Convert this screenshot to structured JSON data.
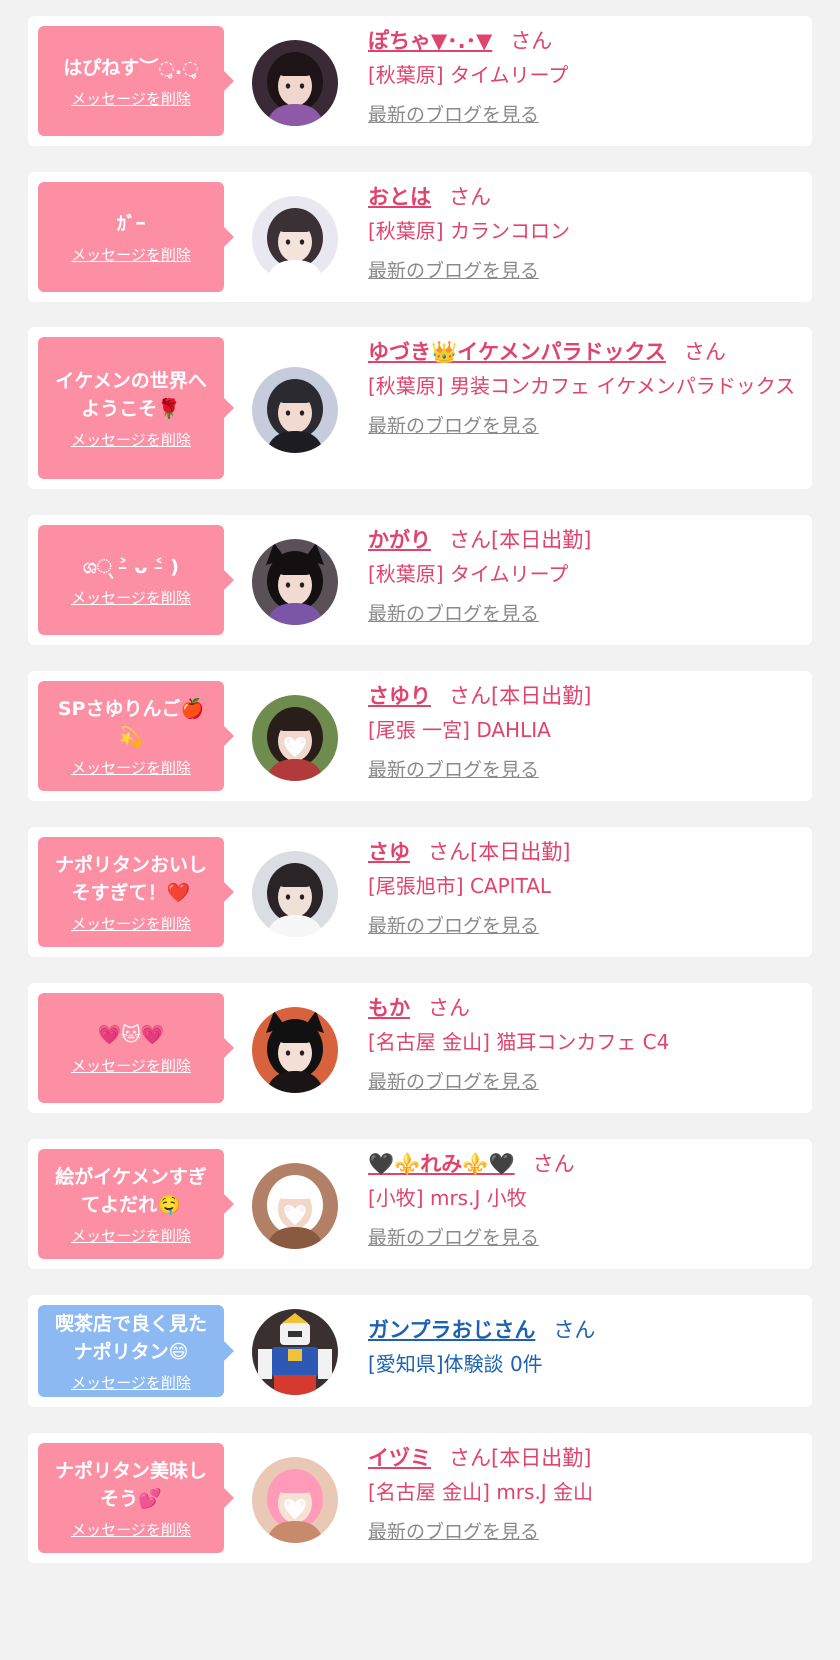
{
  "delete_label": "メッセージを削除",
  "blog_label": "最新のブログを見る",
  "colors": {
    "pink_bubble": "#fd8fa5",
    "blue_bubble": "#8db9f3",
    "pink_text": "#e0436c",
    "blue_text": "#1d62b0",
    "link_gray": "#8a8a8a",
    "background": "#f2f2f2"
  },
  "items": [
    {
      "message": "はぴねす︶◌̥.◌̥",
      "name": "ぽちゃ▼･.･▼",
      "suffix": "さん",
      "shop": "[秋葉原] タイムリープ",
      "blog": true,
      "style": "pink",
      "avatar": "photo-girl-purple-kimono"
    },
    {
      "message": "ｶﾞｰ",
      "name": "おとは",
      "suffix": "さん",
      "shop": "[秋葉原] カランコロン",
      "blog": true,
      "style": "pink",
      "avatar": "photo-girl-white-room"
    },
    {
      "message": "イケメンの世界へ\nようこそ🌹",
      "name": "ゆづき👑イケメンパラドックス",
      "suffix": "さん",
      "shop": "[秋葉原] 男装コンカフェ イケメンパラドックス",
      "blog": true,
      "style": "pink",
      "avatar": "photo-dark-hair-suit"
    },
    {
      "message": "ශ્ ˃̵ ᴗ ˂̵ )",
      "name": "かがり",
      "suffix": "さん[本日出勤]",
      "shop": "[秋葉原] タイムリープ",
      "blog": true,
      "style": "pink",
      "avatar": "photo-cat-ears-purple"
    },
    {
      "message": "SPさゆりんご🍎\n💫",
      "name": "さゆり",
      "suffix": "さん[本日出勤]",
      "shop": "[尾張 一宮] DAHLIA",
      "blog": true,
      "style": "pink",
      "avatar": "photo-apple-orchard"
    },
    {
      "message": "ナポリタンおいし\nそすぎて！❤️",
      "name": "さゆ",
      "suffix": "さん[本日出勤]",
      "shop": "[尾張旭市] CAPITAL",
      "blog": true,
      "style": "pink",
      "avatar": "photo-white-hood"
    },
    {
      "message": "💗🐱💗",
      "name": "もか",
      "suffix": "さん",
      "shop": "[名古屋 金山] 猫耳コンカフェ C4",
      "blog": true,
      "style": "pink",
      "avatar": "photo-cat-ears-black"
    },
    {
      "message": "絵がイケメンすぎ\nてよだれ🤤",
      "name": "🖤⚜️れみ⚜️🖤",
      "suffix": "さん",
      "shop": "[小牧] mrs.J 小牧",
      "blog": true,
      "style": "pink",
      "avatar": "photo-brown-hair-heart"
    },
    {
      "message": "喫茶店で良く見た\nナポリタン😄",
      "name": "ガンプラおじさん",
      "suffix": "さん",
      "shop": "[愛知県]体験談 0件",
      "blog": false,
      "style": "blue",
      "avatar": "photo-gundam-model"
    },
    {
      "message": "ナポリタン美味し\nそう💕",
      "name": "イヅミ",
      "suffix": "さん[本日出勤]",
      "shop": "[名古屋 金山] mrs.J 金山",
      "blog": true,
      "style": "pink",
      "avatar": "photo-light-hair-heart"
    }
  ]
}
